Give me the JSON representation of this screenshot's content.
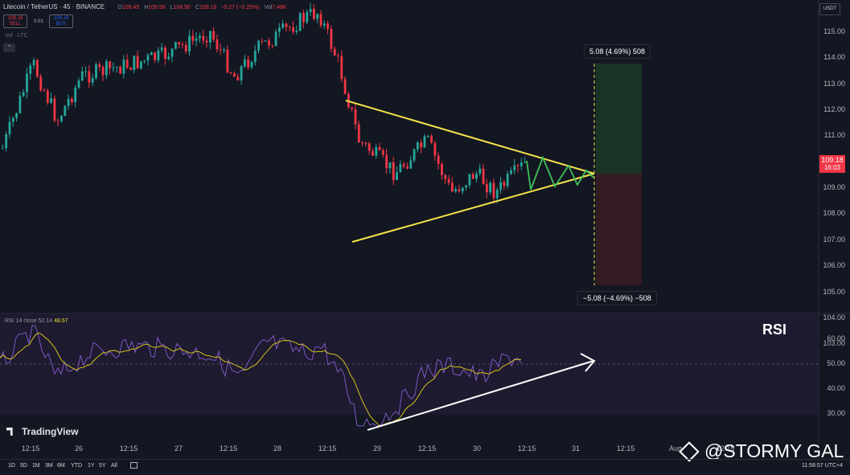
{
  "header": {
    "title": "Litecoin / TetherUS · 45 · BINANCE",
    "open_label": "O",
    "open": "109.45",
    "high_label": "H",
    "high": "109.58",
    "low_label": "L",
    "low": "108.90",
    "close_label": "C",
    "close": "109.18",
    "change": "−0.27 (−0.25%)",
    "vol_label": "Vol",
    "vol": "7.48K"
  },
  "trade": {
    "sell_price": "109.18",
    "sell_label": "SELL",
    "spread": "0.01",
    "buy_price": "109.19",
    "buy_label": "BUY"
  },
  "volume_indicator": "Vol · LTC",
  "currency": "USDT",
  "price_axis": [
    "115.00",
    "114.00",
    "113.00",
    "112.00",
    "111.00",
    "110.00",
    "109.00",
    "108.00",
    "107.00",
    "106.00",
    "105.00",
    "104.00",
    "103.00"
  ],
  "current_price": {
    "value": "109.18",
    "countdown": "16:03",
    "color": "#f23645"
  },
  "position": {
    "target_label": "5.08 (4.69%) 508",
    "stop_label": "−5.08 (−4.69%) −508"
  },
  "rsi": {
    "legend_name": "RSI 14 close",
    "value1": "52.14",
    "value2": "48.67",
    "axis": [
      "60.00",
      "50.00",
      "40.00",
      "30.00"
    ],
    "annotation": "RSI"
  },
  "time_axis": [
    "12:15",
    "26",
    "12:15",
    "27",
    "12:15",
    "28",
    "12:15",
    "29",
    "12:15",
    "30",
    "12:15",
    "31",
    "12:15",
    "Aug",
    "12:15"
  ],
  "branding": {
    "logo": "TradingView",
    "watermark": "@STORMY GAL"
  },
  "bottombar": {
    "ranges": [
      "1D",
      "5D",
      "1M",
      "3M",
      "6M",
      "YTD",
      "1Y",
      "5Y",
      "All"
    ],
    "clock": "11:58:57 UTC+4"
  },
  "colors": {
    "up": "#26a69a",
    "down": "#f23645",
    "trendline": "#f5e44a",
    "projection": "#3fbf5a",
    "rsi_line": "#7e57c2",
    "rsi_ma": "#d4c21a"
  }
}
